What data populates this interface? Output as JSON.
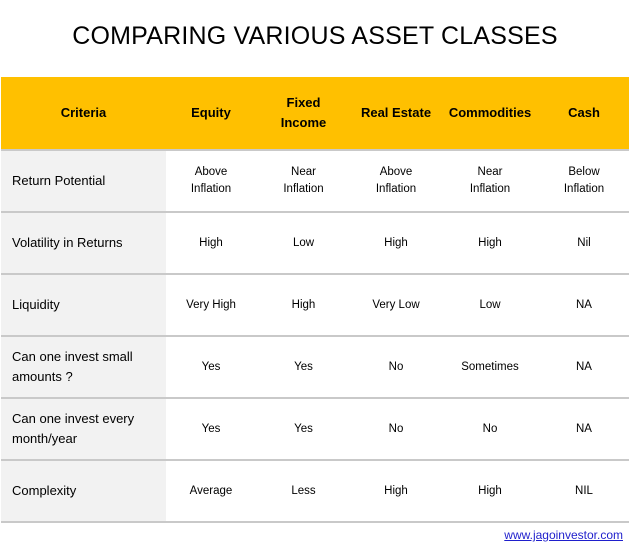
{
  "title": "COMPARING VARIOUS ASSET CLASSES",
  "colors": {
    "header_bg": "#FFC000",
    "criteria_bg": "#F2F2F2",
    "row_divider": "#C9C9C9",
    "link": "#1F1FCC"
  },
  "table": {
    "headers": [
      "Criteria",
      "Equity",
      "Fixed\nIncome",
      "Real Estate",
      "Commodities",
      "Cash"
    ],
    "rows": [
      {
        "criteria": "Return Potential",
        "values": [
          "Above\nInflation",
          "Near\nInflation",
          "Above\nInflation",
          "Near\nInflation",
          "Below\nInflation"
        ]
      },
      {
        "criteria": "Volatility in Returns",
        "values": [
          "High",
          "Low",
          "High",
          "High",
          "Nil"
        ]
      },
      {
        "criteria": "Liquidity",
        "values": [
          "Very High",
          "High",
          "Very Low",
          "Low",
          "NA"
        ]
      },
      {
        "criteria": "Can one invest small\namounts ?",
        "values": [
          "Yes",
          "Yes",
          "No",
          "Sometimes",
          "NA"
        ]
      },
      {
        "criteria": "Can one invest  every\nmonth/year",
        "values": [
          "Yes",
          "Yes",
          "No",
          "No",
          "NA"
        ]
      },
      {
        "criteria": "Complexity",
        "values": [
          "Average",
          "Less",
          "High",
          "High",
          "NIL"
        ]
      }
    ]
  },
  "footer": {
    "link_text": "www.jagoinvestor.com"
  }
}
